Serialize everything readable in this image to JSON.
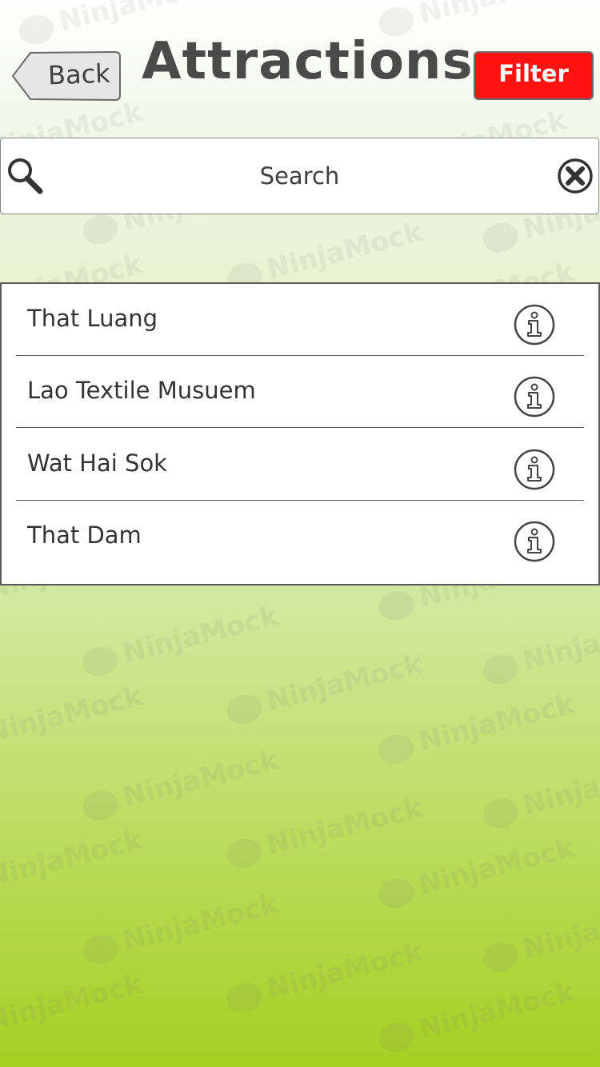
{
  "header": {
    "back_label": "Back",
    "title": "Attractions",
    "filter_label": "Filter"
  },
  "search": {
    "placeholder": "Search"
  },
  "attractions": {
    "items": [
      {
        "label": "That Luang"
      },
      {
        "label": "Lao Textile Musuem"
      },
      {
        "label": "Wat Hai Sok"
      },
      {
        "label": "That Dam"
      }
    ]
  },
  "watermark": {
    "text": "NinjaMock"
  },
  "colors": {
    "filter_button": "#ff1212",
    "background_top": "#ffffff",
    "background_bottom": "#a4d022",
    "ink": "#3a3a3a"
  },
  "icons": {
    "search": "search-icon",
    "clear": "close-circle-icon",
    "info": "info-icon",
    "back": "back-arrow-icon"
  }
}
